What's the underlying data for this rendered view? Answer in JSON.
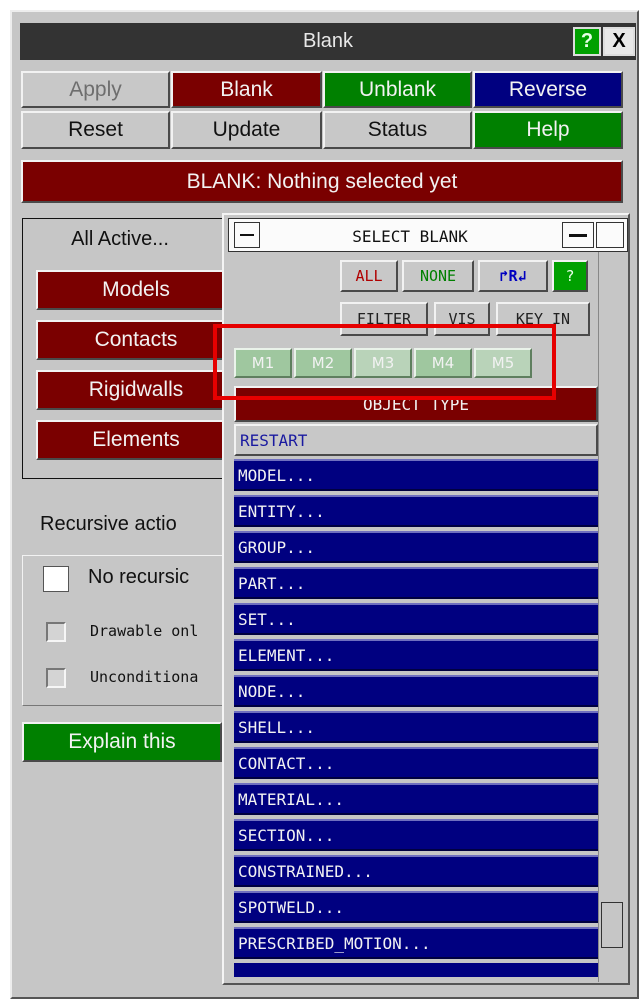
{
  "window": {
    "title": "Blank",
    "help_icon": "?",
    "close_icon": "X"
  },
  "actions": {
    "row1": [
      "Apply",
      "Blank",
      "Unblank",
      "Reverse"
    ],
    "row2": [
      "Reset",
      "Update",
      "Status",
      "Help"
    ]
  },
  "status_bar": "BLANK: Nothing selected yet",
  "left_group": {
    "all_active": "All Active...",
    "buttons": [
      "Models",
      "Contacts",
      "Rigidwalls",
      "Elements"
    ]
  },
  "recursive": {
    "label": "Recursive actio",
    "options": [
      "No recursic",
      "Drawable onl",
      "Unconditiona"
    ]
  },
  "explain": "Explain this",
  "popup": {
    "title": "SELECT BLANK",
    "buttons": {
      "all": "ALL",
      "none": "NONE",
      "reverse": "R",
      "help": "?"
    },
    "filters": [
      "FILTER",
      "VIS",
      "KEY_IN"
    ],
    "models": [
      "M1",
      "M2",
      "M3",
      "M4",
      "M5"
    ],
    "object_type": "OBJECT TYPE",
    "restart": "RESTART",
    "items": [
      "MODEL...",
      "ENTITY...",
      "GROUP...",
      "PART...",
      "SET...",
      "ELEMENT...",
      "NODE...",
      "SHELL...",
      "CONTACT...",
      "MATERIAL...",
      "SECTION...",
      "CONSTRAINED...",
      "SPOTWELD...",
      "PRESCRIBED_MOTION..."
    ]
  },
  "colors": {
    "red": "#7a0000",
    "green": "#008000",
    "blue": "#000080",
    "highlight": "#e60000"
  }
}
